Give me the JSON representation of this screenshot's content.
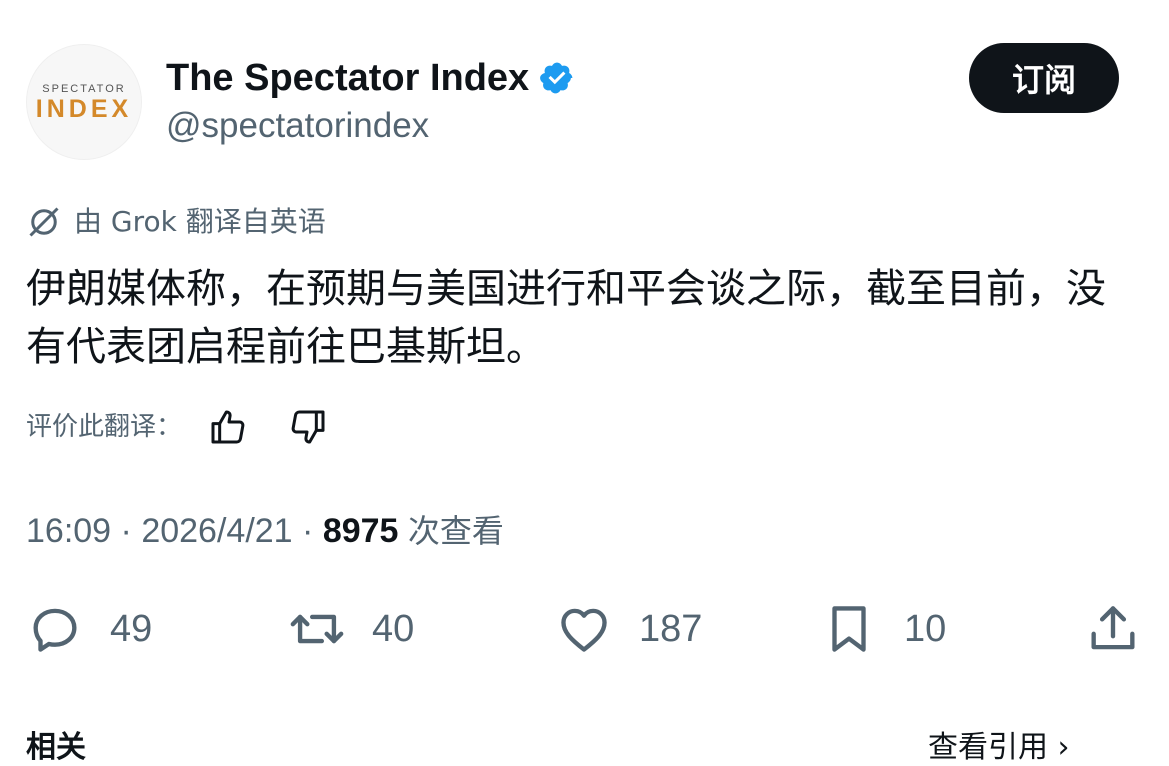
{
  "account": {
    "avatar_line1": "SPECTATOR",
    "avatar_line2": "INDEX",
    "name": "The Spectator Index",
    "handle": "@spectatorindex",
    "subscribe_label": "订阅",
    "verified_color": "#1d9bf0"
  },
  "translation": {
    "source": "由 Grok 翻译自英语",
    "text": "伊朗媒体称，在预期与美国进行和平会谈之际，截至目前，没有代表团启程前往巴基斯坦。",
    "rate_label": "评价此翻译："
  },
  "meta": {
    "time": "16:09",
    "date": "2026/4/21",
    "views": "8975",
    "views_label": "次查看"
  },
  "actions": {
    "replies": "49",
    "reposts": "40",
    "likes": "187",
    "bookmarks": "10"
  },
  "footer": {
    "left": "相关",
    "right": "查看引用 ›"
  }
}
